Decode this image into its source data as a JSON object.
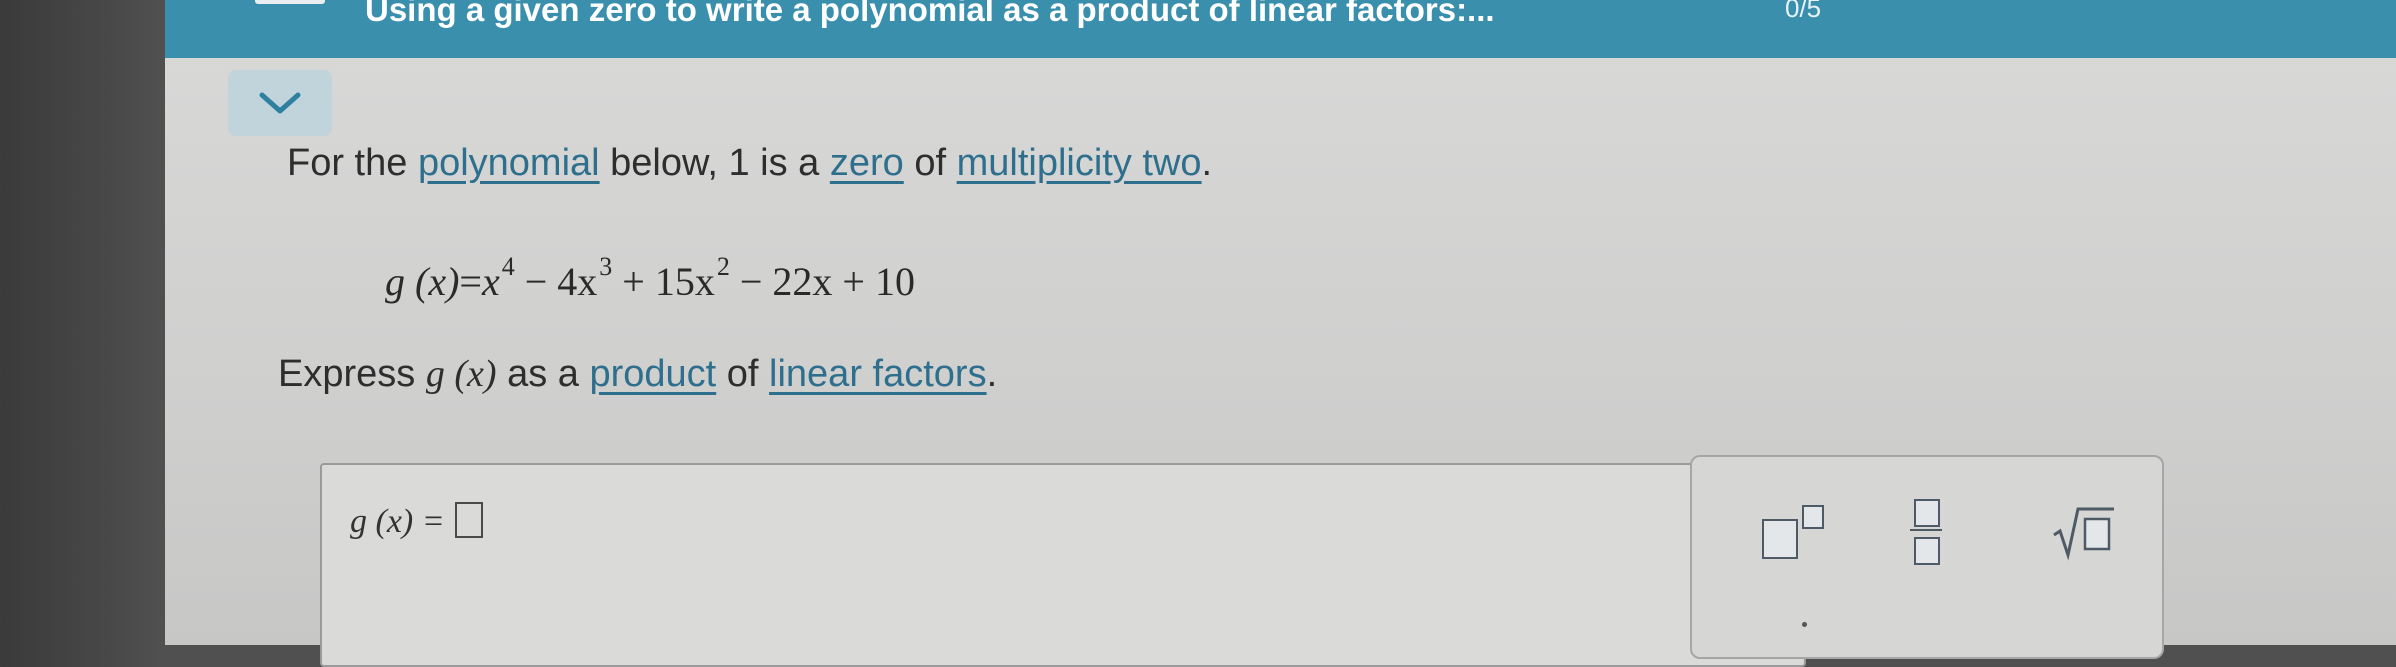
{
  "header": {
    "topic_title": "Using a given zero to write a polynomial as a product of linear factors:...",
    "progress": "0/5"
  },
  "prompt": {
    "intro_1": "For the ",
    "link_polynomial": "polynomial",
    "intro_2": " below, 1 is a ",
    "link_zero": "zero",
    "intro_3": " of ",
    "link_multiplicity": "multiplicity two",
    "intro_4": "."
  },
  "equation": {
    "lhs": "g (x)",
    "eq": "=",
    "t1": "x",
    "e1": "4",
    "t2": " − 4x",
    "e2": "3",
    "t3": " + 15x",
    "e3": "2",
    "t4": " − 22x + 10"
  },
  "task": {
    "prefix": "Express ",
    "func": "g (x)",
    "mid": " as a ",
    "link_product": "product",
    "of": " of ",
    "link_linear": "linear factors",
    "end": "."
  },
  "answer": {
    "label": "g (x) ="
  },
  "tools": [
    "superscript-template",
    "fraction-template",
    "square-root-template"
  ],
  "colors": {
    "header_bg": "#3a8fad",
    "link": "#2f6f8e",
    "collapse_button_bg": "#c1d4dc"
  }
}
